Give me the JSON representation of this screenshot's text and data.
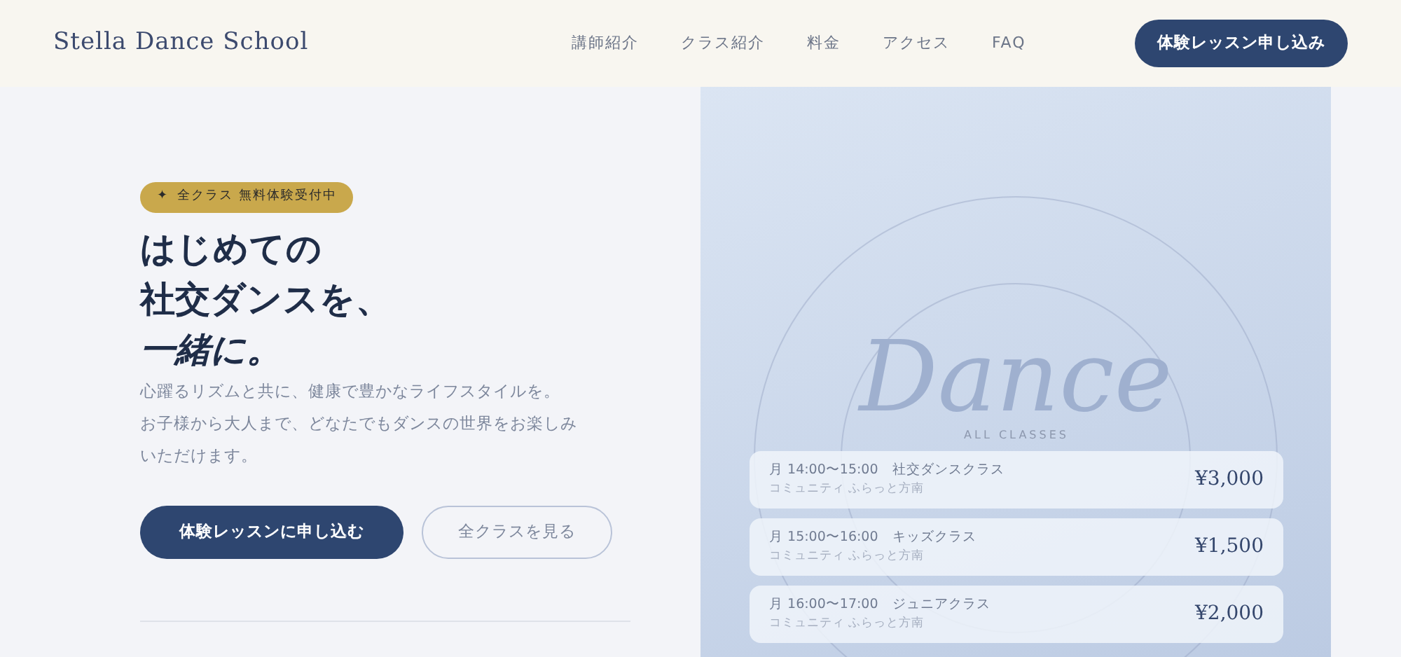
{
  "header": {
    "logo": "Stella Dance School",
    "nav": [
      {
        "label": "講師紹介"
      },
      {
        "label": "クラス紹介"
      },
      {
        "label": "料金"
      },
      {
        "label": "アクセス"
      },
      {
        "label": "FAQ"
      }
    ],
    "cta": "体験レッスン申し込み"
  },
  "hero": {
    "badge": {
      "icon": "✦",
      "text": "全クラス 無料体験受付中"
    },
    "headline": [
      "はじめての",
      "社交ダンスを、"
    ],
    "headline_emphasis": "一緒に。",
    "lead": [
      "心躍るリズムと共に、健康で豊かなライフスタイルを。",
      "お子様から大人まで、どなたでもダンスの世界をお楽しみいただけます。"
    ],
    "buttons": [
      {
        "label": "体験レッスンに申し込む",
        "kind": "primary"
      },
      {
        "label": "全クラスを見る",
        "kind": "outline"
      }
    ]
  },
  "panel": {
    "backdrop_word": "Dance",
    "title": "ALL CLASSES",
    "classes": [
      {
        "schedule": "月 14:00〜15:00　社交ダンスクラス",
        "venue": "コミュニティ ふらっと方南",
        "price": "¥3,000"
      },
      {
        "schedule": "月 15:00〜16:00　キッズクラス",
        "venue": "コミュニティ ふらっと方南",
        "price": "¥1,500"
      },
      {
        "schedule": "月 16:00〜17:00　ジュニアクラス",
        "venue": "コミュニティ ふらっと方南",
        "price": "¥2,000"
      }
    ]
  }
}
